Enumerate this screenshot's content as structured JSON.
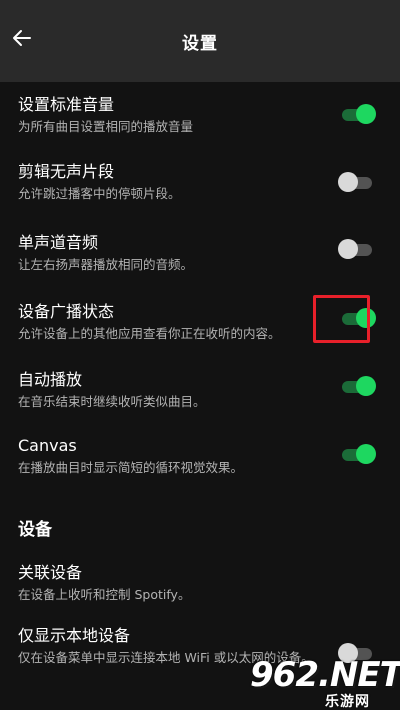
{
  "header": {
    "title": "设置",
    "back_icon": "arrow-left-icon"
  },
  "settings": [
    {
      "title": "设置标准音量",
      "desc": "为所有曲目设置相同的播放音量",
      "enabled": true
    },
    {
      "title": "剪辑无声片段",
      "desc": "允许跳过播客中的停顿片段。",
      "enabled": false
    },
    {
      "title": "单声道音频",
      "desc": "让左右扬声器播放相同的音频。",
      "enabled": false
    },
    {
      "title": "设备广播状态",
      "desc": "允许设备上的其他应用查看你正在收听的内容。",
      "enabled": true
    },
    {
      "title": "自动播放",
      "desc": "在音乐结束时继续收听类似曲目。",
      "enabled": true
    },
    {
      "title": "Canvas",
      "desc": "在播放曲目时显示简短的循环视觉效果。",
      "enabled": true
    }
  ],
  "devices_section": {
    "header": "设备",
    "items": [
      {
        "title": "关联设备",
        "desc": "在设备上收听和控制 Spotify。"
      },
      {
        "title": "仅显示本地设备",
        "desc": "仅在设备菜单中显示连接本地 WiFi 或以太网的设备。",
        "enabled": false
      }
    ]
  },
  "watermark": {
    "logo_text": "962.NET",
    "sub_text": "乐游网"
  },
  "colors": {
    "background": "#121212",
    "topbar": "#2a2a2a",
    "accent_green": "#1ed760",
    "highlight_red": "#e8202a"
  }
}
